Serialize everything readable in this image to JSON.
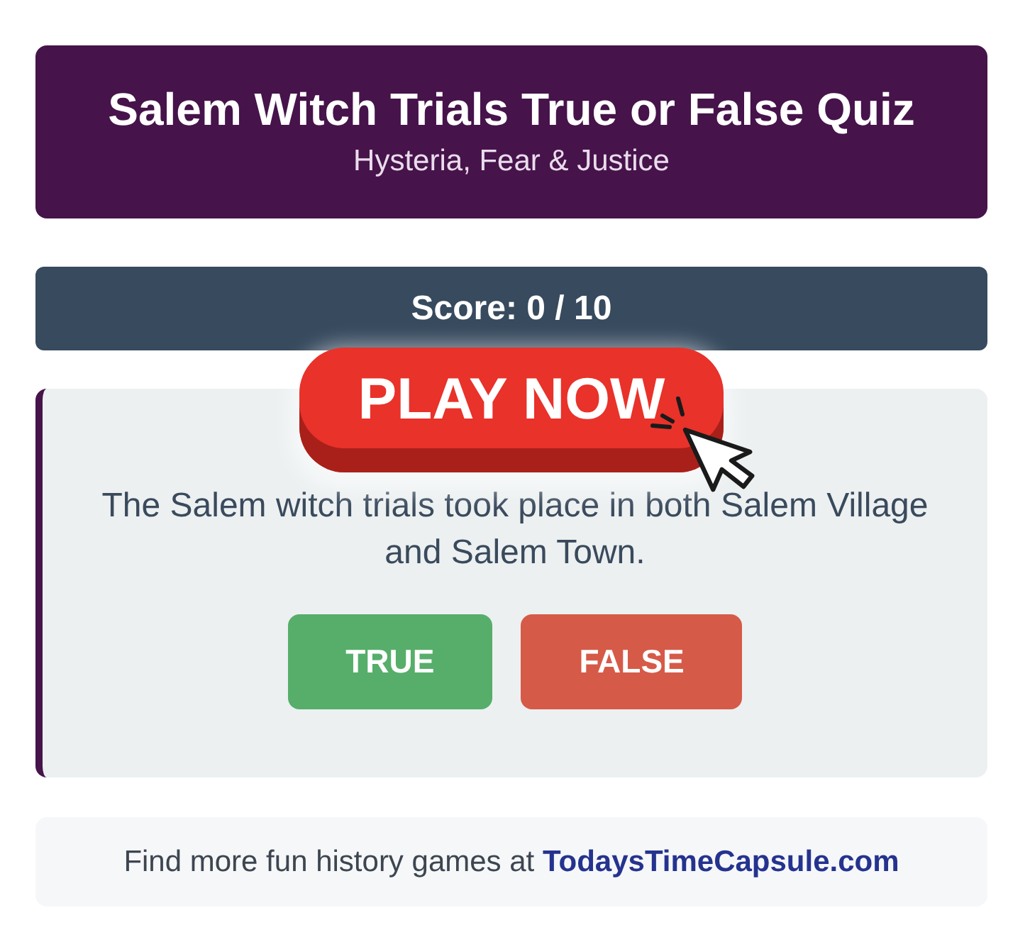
{
  "header": {
    "title": "Salem Witch Trials True or False Quiz",
    "subtitle": "Hysteria, Fear & Justice"
  },
  "score": {
    "text": "Score: 0 / 10"
  },
  "question": {
    "text": "The Salem witch trials took place in both Salem Village and Salem Town.",
    "answers": [
      {
        "label": "TRUE",
        "kind": "true"
      },
      {
        "label": "FALSE",
        "kind": "false"
      }
    ]
  },
  "footer": {
    "text": "Find more fun history games at",
    "link": "TodaysTimeCapsule.com"
  },
  "overlay": {
    "button": "PLAY NOW"
  }
}
